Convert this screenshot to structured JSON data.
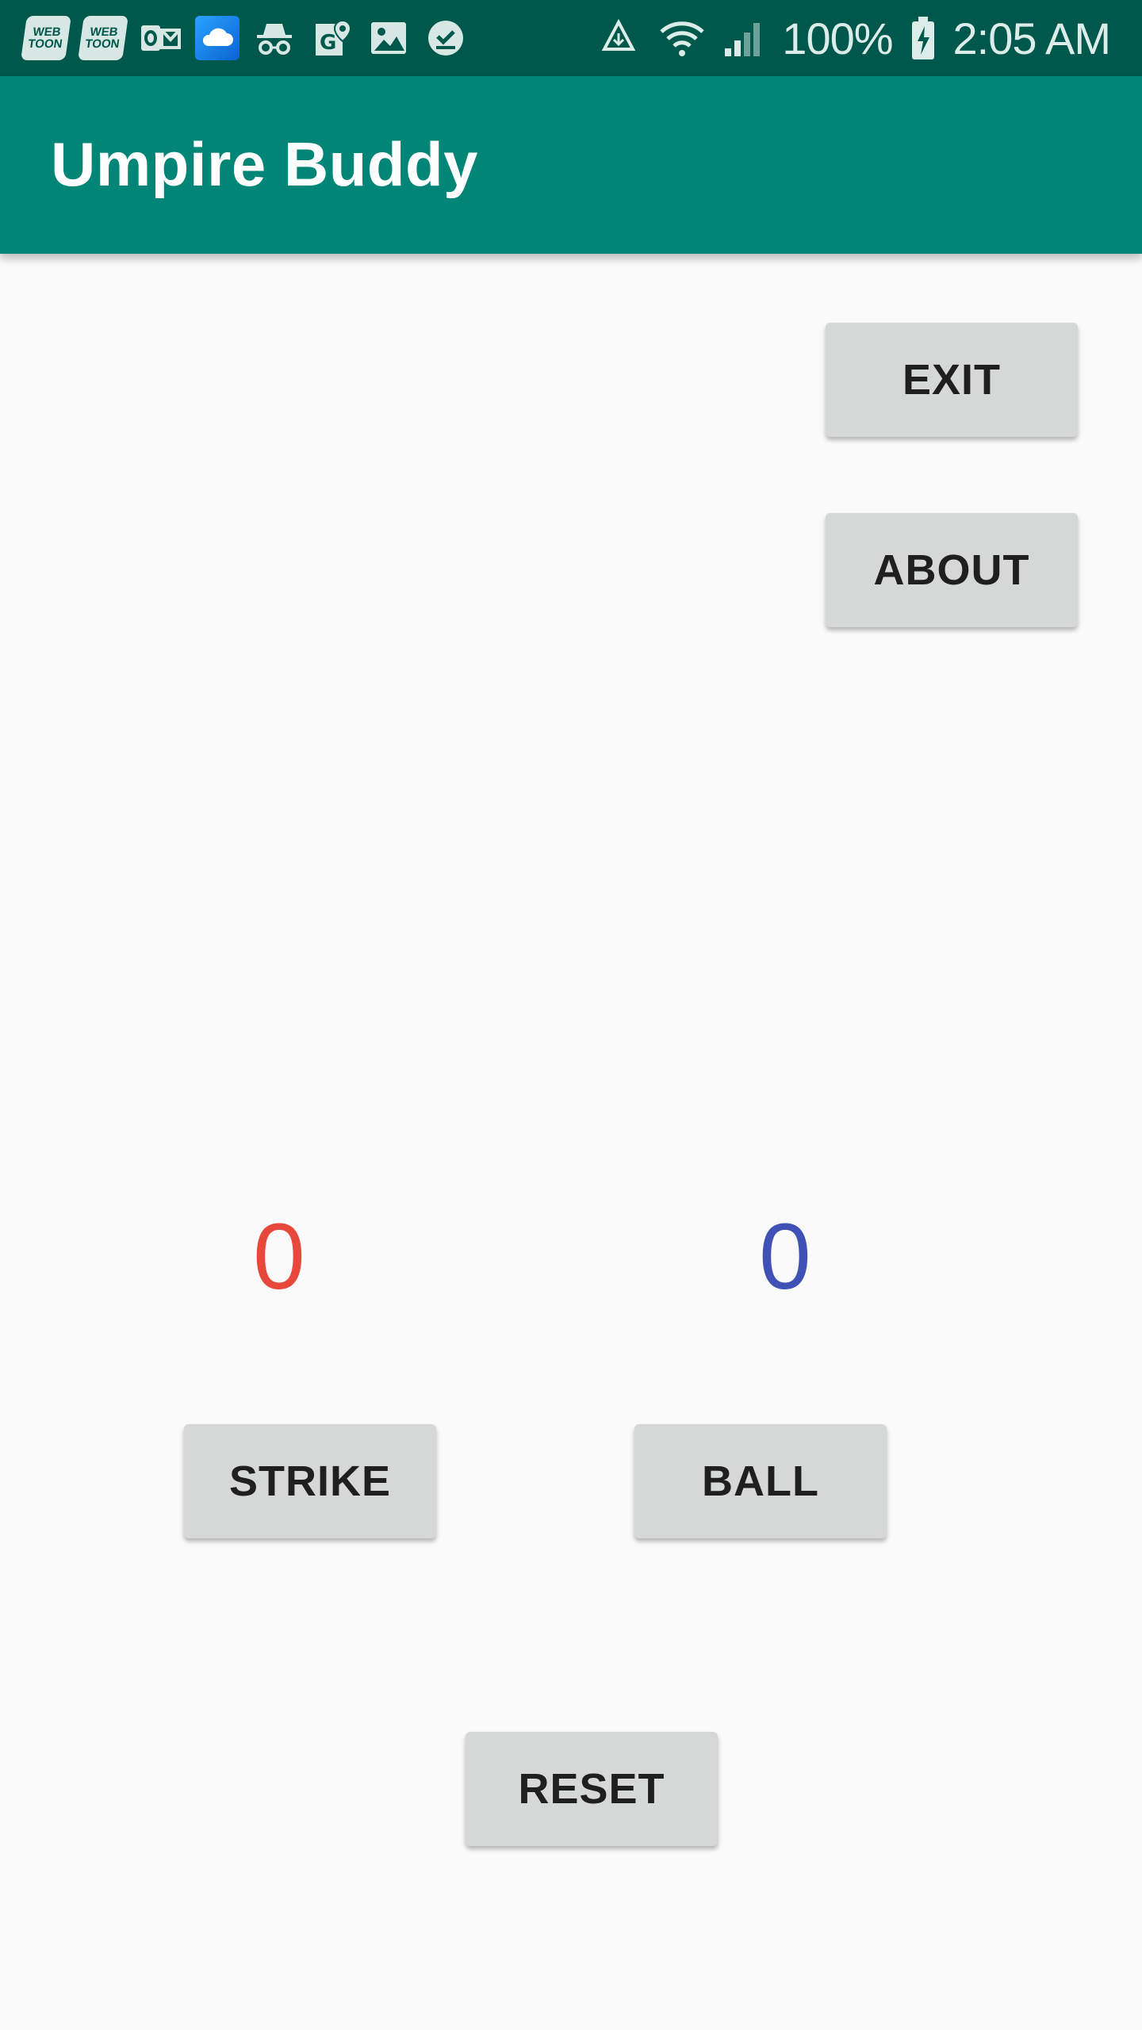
{
  "status_bar": {
    "notification_icons": [
      {
        "name": "webtoon-icon",
        "label": "WEB TOON"
      },
      {
        "name": "webtoon-icon",
        "label": "WEB TOON"
      },
      {
        "name": "outlook-icon"
      },
      {
        "name": "cloud-icon"
      },
      {
        "name": "incognito-icon"
      },
      {
        "name": "maps-icon"
      },
      {
        "name": "gallery-icon"
      },
      {
        "name": "check-circle-icon"
      }
    ],
    "battery_percent": "100%",
    "time": "2:05 AM",
    "colors": {
      "background": "#00574b"
    }
  },
  "app_bar": {
    "title": "Umpire Buddy",
    "color": "#008577"
  },
  "buttons": {
    "exit": "EXIT",
    "about": "ABOUT",
    "strike": "STRIKE",
    "ball": "BALL",
    "reset": "RESET"
  },
  "counts": {
    "strike": "0",
    "ball": "0",
    "strike_color": "#e8473c",
    "ball_color": "#3f51b5"
  }
}
